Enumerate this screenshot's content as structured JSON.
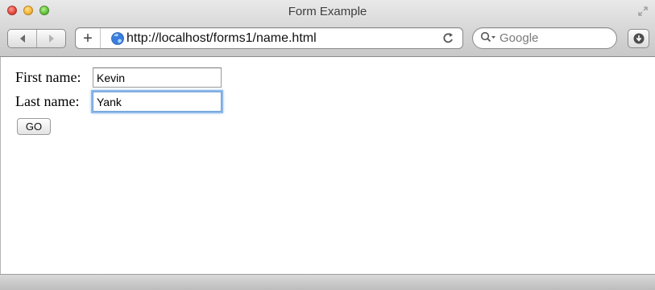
{
  "window": {
    "title": "Form Example"
  },
  "toolbar": {
    "url": "http://localhost/forms1/name.html",
    "search_placeholder": "Google",
    "new_tab_label": "+"
  },
  "form": {
    "first_name_label": "First name:",
    "first_name_value": "Kevin",
    "last_name_label": "Last name:",
    "last_name_value": "Yank",
    "submit_label": "GO"
  },
  "icons": {
    "close": "close-icon",
    "minimize": "minimize-icon",
    "zoom": "zoom-icon",
    "fullscreen": "fullscreen-icon",
    "back": "back-arrow-icon",
    "forward": "forward-arrow-icon",
    "globe": "globe-icon",
    "reload": "reload-icon",
    "search": "search-icon",
    "downloads": "downloads-icon"
  },
  "colors": {
    "close": "#e2463a",
    "minimize": "#f4b53a",
    "zoom": "#5fc23b",
    "focus_ring": "#8fb9ea",
    "globe": "#3b7ddd"
  }
}
